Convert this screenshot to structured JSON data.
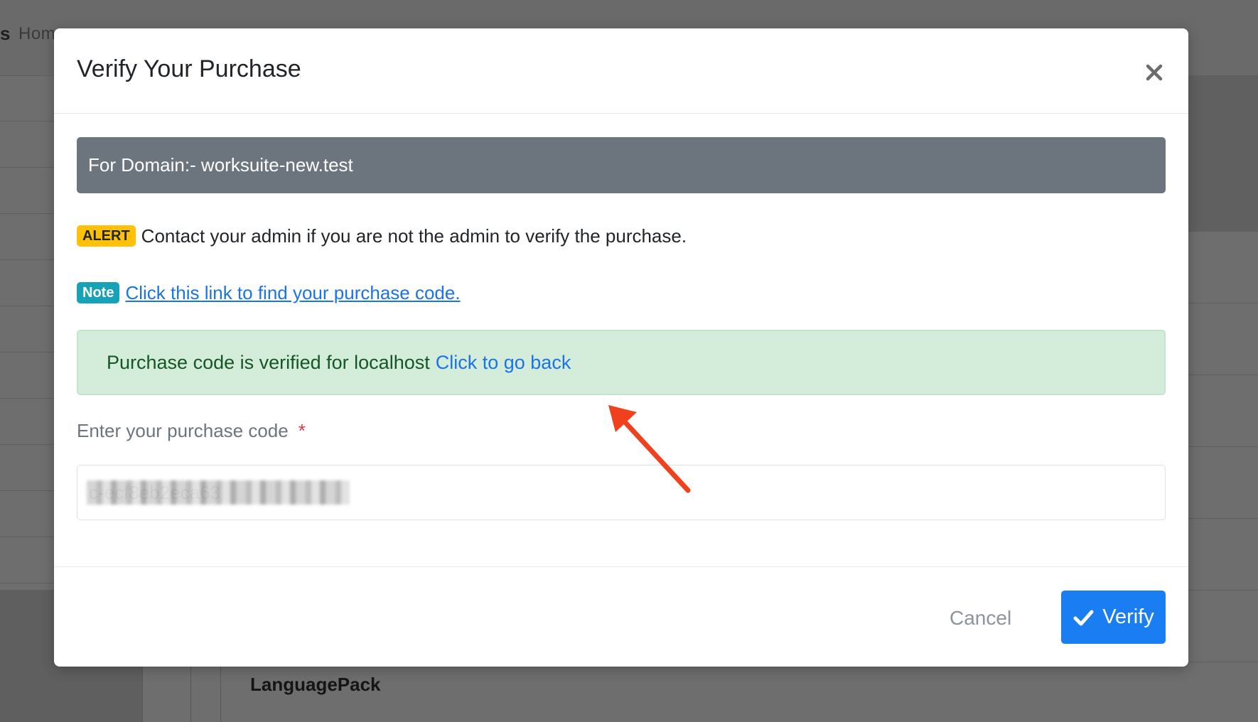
{
  "background": {
    "breadcrumb_partial": "Hom",
    "brand_partial": "s",
    "bottom_item": "LanguagePack"
  },
  "modal": {
    "title": "Verify Your Purchase",
    "domain_banner": "For Domain:- worksuite-new.test",
    "alert": {
      "badge": "ALERT",
      "text": "Contact your admin if you are not the admin to verify the purchase."
    },
    "note": {
      "badge": "Note",
      "link_text": "Click this link to find your purchase code."
    },
    "success": {
      "text": "Purchase code is verified for localhost",
      "link_text": "Click to go back"
    },
    "purchase_code": {
      "label": "Enter your purchase code",
      "required_mark": "*",
      "value": "c-ecf8eb2eca63"
    },
    "footer": {
      "cancel_label": "Cancel",
      "verify_label": "Verify"
    }
  },
  "icons": {
    "close": "close-icon",
    "verify": "checkmark-icon",
    "annotation": "arrow-annotation-icon"
  },
  "colors": {
    "primary": "#1a7ef2",
    "banner": "#6c757d",
    "success_bg": "#d4edda",
    "success_text": "#155724",
    "warning": "#ffc107",
    "info": "#17a2b8",
    "annotation_arrow": "#f0401e"
  }
}
